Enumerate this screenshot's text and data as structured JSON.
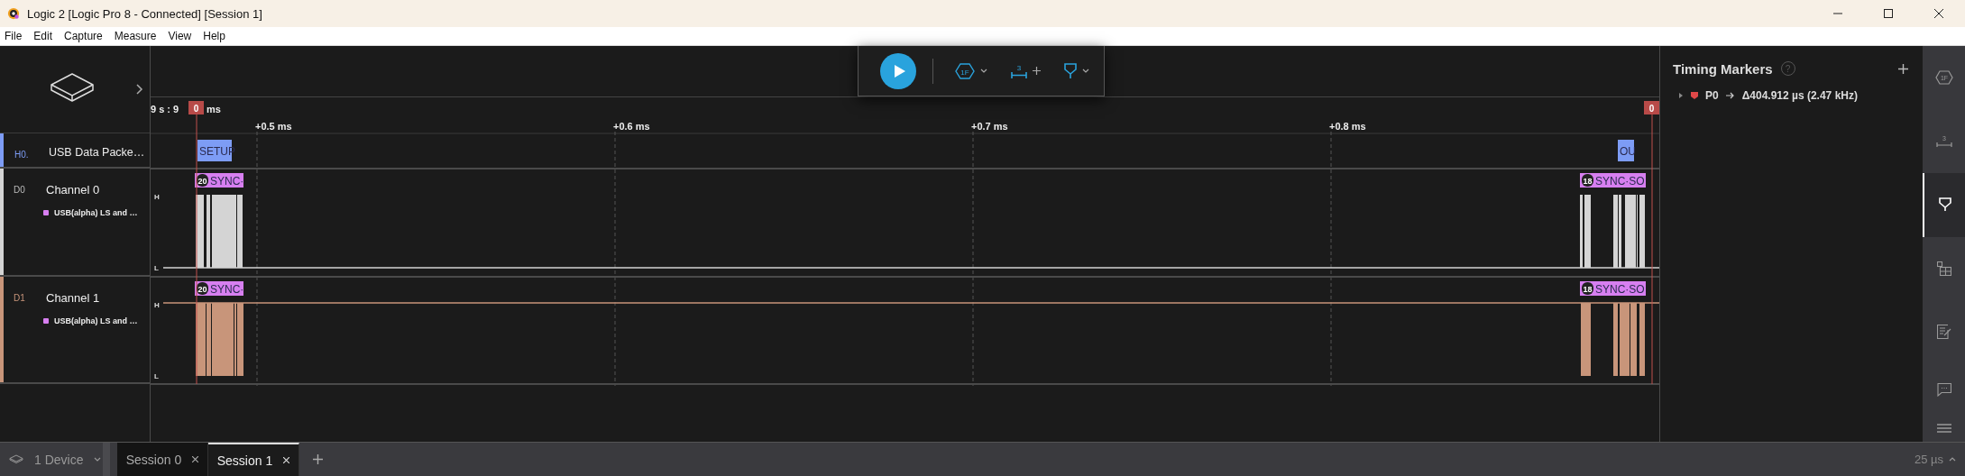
{
  "window": {
    "title": "Logic 2 [Logic Pro 8 - Connected] [Session 1]"
  },
  "menu": [
    "File",
    "Edit",
    "Capture",
    "Measure",
    "View",
    "Help"
  ],
  "toolbar": [
    {
      "kind": "play"
    },
    {
      "kind": "analyzers",
      "label": "1F"
    },
    {
      "kind": "measurements",
      "label": "3"
    },
    {
      "kind": "markers"
    }
  ],
  "ruler": {
    "origin": "9 s : 9",
    "origin_unit": "ms",
    "ticks": [
      "+0.5 ms",
      "+0.6 ms",
      "+0.7 ms",
      "+0.8 ms"
    ]
  },
  "markers": [
    {
      "label": "0"
    },
    {
      "label": "0"
    }
  ],
  "channels": [
    {
      "kind": "analyzer",
      "id": "H0.",
      "name": "USB Data Packe…",
      "color": "#7d9cf5",
      "frames": [
        {
          "text": "SETUP"
        },
        {
          "text": "OU"
        }
      ]
    },
    {
      "kind": "digital",
      "id": "D0",
      "name": "Channel 0",
      "color": "#d4d4d4",
      "analyzer": {
        "name": "USB(alpha) LS and …",
        "color": "#d77ff0"
      },
      "high_label": "H",
      "low_label": "L",
      "frames": [
        {
          "count": "20",
          "text": "SYNC·"
        },
        {
          "count": "18",
          "text": "SYNC·SO"
        }
      ]
    },
    {
      "kind": "digital",
      "id": "D1",
      "name": "Channel 1",
      "color": "#c8957a",
      "analyzer": {
        "name": "USB(alpha) LS and …",
        "color": "#d77ff0"
      },
      "high_label": "H",
      "low_label": "L",
      "frames": [
        {
          "count": "20",
          "text": "SYNC·"
        },
        {
          "count": "18",
          "text": "SYNC·SO"
        }
      ]
    }
  ],
  "panel": {
    "title": "Timing Markers",
    "help": "?",
    "markers": [
      {
        "expanded": false,
        "color": "#e04848",
        "name": "P0",
        "value": "Δ404.912 µs (2.47 kHz)"
      }
    ]
  },
  "sidebar": [
    {
      "kind": "analyzers",
      "label": "1F",
      "selected": false
    },
    {
      "kind": "measurements",
      "label": "3",
      "selected": false
    },
    {
      "kind": "markers",
      "selected": true
    },
    {
      "kind": "extensions",
      "selected": false
    },
    {
      "kind": "notes",
      "selected": false
    },
    {
      "kind": "feedback",
      "selected": false
    },
    {
      "kind": "menu",
      "selected": false
    }
  ],
  "bottom": {
    "device": "1 Device",
    "tabs": [
      {
        "label": "Session 0",
        "selected": false
      },
      {
        "label": "Session 1",
        "selected": true
      }
    ],
    "timescale": "25 µs"
  }
}
